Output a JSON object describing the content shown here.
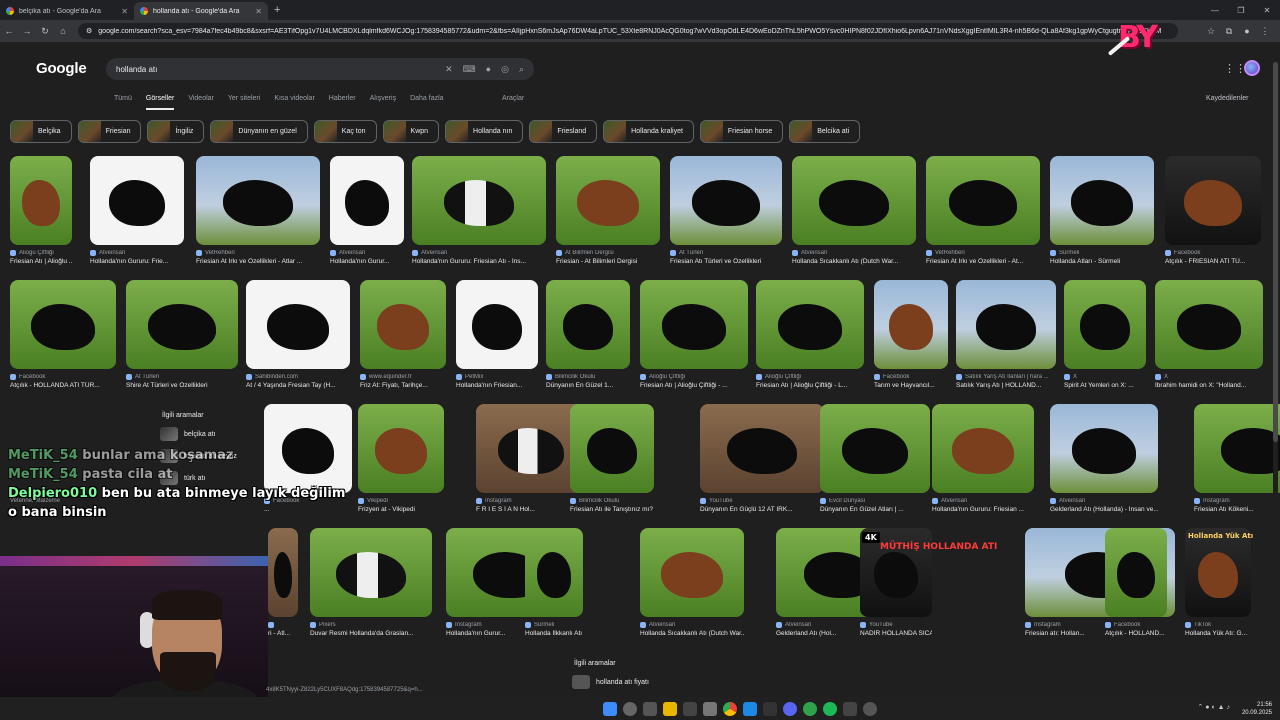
{
  "tabs": [
    {
      "title": "belçika atı - Google'da Ara"
    },
    {
      "title": "hollanda atı - Google'da Ara"
    }
  ],
  "new_tab_icon": "plus-icon",
  "address": {
    "url": "google.com/search?sca_esv=7984a7fec4b49bc8&sxsrf=AE3TifOpg1v7U4LMCBDXLdqlmfkd6WCJOg:1758394585772&udm=2&fbs=AIIjpHxnS6mJsAp76DW4aLpTUC_53Xte8RNJ0AcQG0tog7wVVd3opOdLE4D6wEoDZnThL5hPWO5Ysvc0HIPN8f02JDfIXhio6Lpvn6AJ71nVNdsXggIEntIMIL3R4-nh5B6d-QLa8Af3kg1gpWyCtgugtmyP7-9FKoM"
  },
  "logo_text": "Google",
  "overlay_logo": "BY",
  "search": {
    "query": "hollanda atı"
  },
  "nav": {
    "tabs": [
      "Tümü",
      "Görseller",
      "Videolar",
      "Yer siteleri",
      "Kısa videolar",
      "Haberler",
      "Alışveriş",
      "Daha fazla"
    ],
    "selected": "Görseller",
    "tools": "Araçlar",
    "saved": "Kaydedilenler"
  },
  "chips": [
    "Belçika",
    "Friesian",
    "İngiliz",
    "Dünyanın en güzel",
    "Kaç ton",
    "Kwpn",
    "Hollanda nın",
    "Friesland",
    "Hollanda kraliyet",
    "Friesian horse",
    "Belcika ati"
  ],
  "rows": [
    [
      {
        "src": "Aliogu Çiftliği",
        "title": "Friesian Atı | Alioğlu ..."
      },
      {
        "src": "Atveinsan",
        "title": "Hollanda'nın Gururu: Frie..."
      },
      {
        "src": "VetRehberi",
        "title": "Friesian At Irkı ve Özellikleri - Atlar ..."
      },
      {
        "src": "Atveinsan",
        "title": "Hollanda'nın Gurur..."
      },
      {
        "src": "Atveinsan",
        "title": "Hollanda'nın Gururu: Friesian Atı - İns..."
      },
      {
        "src": "At Bilimleri Dergisi",
        "title": "Friesian - At Bilimleri Dergisi"
      },
      {
        "src": "At Türleri",
        "title": "Friesian Atı Türleri ve Özellikleri"
      },
      {
        "src": "Atveinsan",
        "title": "Hollanda Sıcakkanlı Atı (Dutch War..."
      },
      {
        "src": "VetRehberi",
        "title": "Friesian At Irkı ve Özellikleri - At..."
      },
      {
        "src": "Sürmeli",
        "title": "Hollanda Atları - Sürmeli"
      },
      {
        "src": "Facebook",
        "title": "Atçılık - FRIESIAN ATI TÜ..."
      }
    ],
    [
      {
        "src": "Facebook",
        "title": "Atçılık - HOLLANDA ATI TÜR..."
      },
      {
        "src": "At Türleri",
        "title": "Shire At Türleri ve Özellikleri"
      },
      {
        "src": "Sahibinden.com",
        "title": "At / 4 Yaşında Fresian Tay (H..."
      },
      {
        "src": "www.equinder.fr",
        "title": "Friz At: Fiyatı, Tarihçe..."
      },
      {
        "src": "PetMix",
        "title": "Hollanda'nın Friesian..."
      },
      {
        "src": "Bilimcilik Okulu",
        "title": "Dünyanın En Güzel 1..."
      },
      {
        "src": "Alioğlu Çiftliği",
        "title": "Friesian Atı | Alioğlu Çiftliği - ..."
      },
      {
        "src": "Alioğlu Çiftliği",
        "title": "Friesian Atı | Alioğlu Çiftliği - L..."
      },
      {
        "src": "Facebook",
        "title": "Tarım ve Hayvancıl..."
      },
      {
        "src": "Satılık Yarış Atı İlanları | hara ...",
        "title": "Satılık Yarış Atı | HOLLAND..."
      },
      {
        "src": "X",
        "title": "Spirit At Yemleri on X: ..."
      },
      {
        "src": "X",
        "title": "İbrahim hamidi on X: \"Holland..."
      }
    ],
    [
      {
        "src": "Facebook",
        "title": "..."
      },
      {
        "src": "Vikipedi",
        "title": "Frizyen at - Vikipedi"
      },
      {
        "src": "Instagram",
        "title": "F R I E S İ A N Hol..."
      },
      {
        "src": "Bilimcilik Okulu",
        "title": "Friesian Atı ile Tanıştınız mı? - Fri..."
      },
      {
        "src": "YouTube",
        "title": "Dünyanın En Güçlü 12 AT IRK..."
      },
      {
        "src": "Evcil Dünyası",
        "title": "Dünyanın En Güzel Atları | ..."
      },
      {
        "src": "Atveinsan",
        "title": "Hollanda'nın Gururu: Friesian ..."
      },
      {
        "src": "Atveinsan",
        "title": "Gelderland Atı (Hollanda) - İnsan ve..."
      },
      {
        "src": "Instagram",
        "title": "Friesian Atı Kökeni..."
      }
    ],
    [
      {
        "src": "",
        "title": "ri - Atl..."
      },
      {
        "src": "Pixers",
        "title": "Duvar Resmi Hollanda'da Graslan..."
      },
      {
        "src": "Instagram",
        "title": "Hollanda'nın Gurur..."
      },
      {
        "src": "Sürmeli",
        "title": "Hollanda İlkkanlı Atı - Sürmeli"
      },
      {
        "src": "Atveinsan",
        "title": "Hollanda Sıcakkanlı Atı (Dutch War..."
      },
      {
        "src": "Atveinsan",
        "title": "Gelderland Atı (Hol..."
      },
      {
        "src": "YouTube",
        "title": "NADİR HOLLANDA SICAK KANLI ATINI KI..."
      },
      {
        "src": "Instagram",
        "title": "Friesian atı: Hollan..."
      },
      {
        "src": "Facebook",
        "title": "Atçılık - HOLLAND..."
      },
      {
        "src": "TikTok",
        "title": "Hollanda Yük Atı: G..."
      }
    ]
  ],
  "related": {
    "heading": "İlgili aramalar",
    "items": [
      "belçika atı",
      "friesian atı beyaz",
      "türk atı"
    ]
  },
  "related2": {
    "heading": "İlgili aramalar",
    "items": [
      "hollanda atı fiyatı"
    ]
  },
  "chat": [
    {
      "name": "MeTiK_54",
      "text": "bunlar ama koşamaz"
    },
    {
      "name": "MeTiK_54",
      "text": "pasta cila at"
    },
    {
      "name": "Delpiero010",
      "text": "ben bu ata binmeye layık değilim o bana binsin"
    }
  ],
  "thumb_overlays": {
    "video_text": "MÜTHİŞ HOLLANDA ATI",
    "badge_4k": "4K",
    "tiktok_text": "Hollanda Yük Atı"
  },
  "partial_src": "Veteriner Malzeme",
  "cam_url": "4x8K5TNyyi-Z822Ly5CUXF8AQdg:1758394587725&q=h...",
  "clock": {
    "time": "21:56",
    "date": "20.09.2025"
  },
  "colors": {
    "bg": "#1f1f1f",
    "accent": "#8ab4f8",
    "chat_name": "#7CFC9a",
    "logo": "#ff2a6d"
  }
}
